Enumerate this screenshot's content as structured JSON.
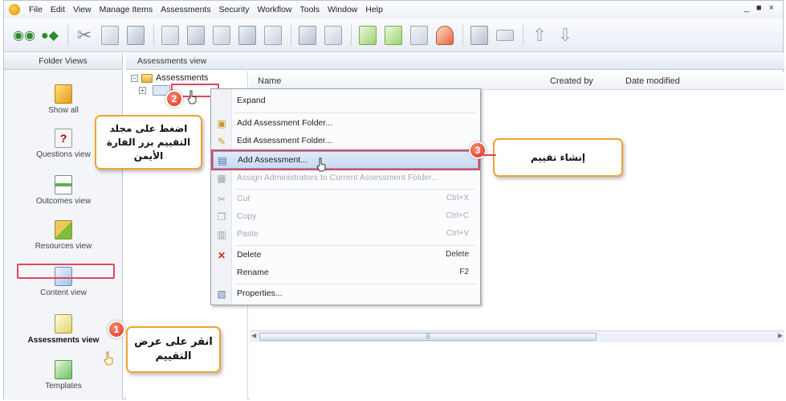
{
  "menu": [
    "File",
    "Edit",
    "View",
    "Manage Items",
    "Assessments",
    "Security",
    "Workflow",
    "Tools",
    "Window",
    "Help"
  ],
  "window_controls": "_ ■ ×",
  "left_pane": {
    "header": "Folder Views",
    "items": [
      {
        "label": "Show all",
        "icon": "cube-icon"
      },
      {
        "label": "Questions view",
        "icon": "question-icon"
      },
      {
        "label": "Outcomes view",
        "icon": "outcomes-icon"
      },
      {
        "label": "Resources view",
        "icon": "resources-icon"
      },
      {
        "label": "Content view",
        "icon": "content-icon"
      },
      {
        "label": "Assessments view",
        "icon": "assessment-icon"
      },
      {
        "label": "Templates",
        "icon": "template-icon"
      }
    ]
  },
  "tree": {
    "header": "Assessments view",
    "root": "Assessments",
    "expander": "−",
    "child_expander": "+"
  },
  "list": {
    "columns": [
      "Name",
      "Created by",
      "Date modified"
    ]
  },
  "context_menu": {
    "items": [
      {
        "label": "Expand",
        "shortcut": "",
        "icon": ""
      },
      {
        "label": "Add Assessment Folder...",
        "shortcut": "",
        "icon": "add-folder-icon"
      },
      {
        "label": "Edit Assessment Folder...",
        "shortcut": "",
        "icon": "edit-folder-icon"
      },
      {
        "label": "Add Assessment...",
        "shortcut": "",
        "icon": "add-assessment-icon"
      },
      {
        "label": "Assign Administrators to Current Assessment Folder...",
        "shortcut": "",
        "icon": "assign-icon"
      },
      {
        "label": "Cut",
        "shortcut": "Ctrl+X",
        "icon": "scissors-icon"
      },
      {
        "label": "Copy",
        "shortcut": "Ctrl+C",
        "icon": "copy-icon"
      },
      {
        "label": "Paste",
        "shortcut": "Ctrl+V",
        "icon": "paste-icon"
      },
      {
        "label": "Delete",
        "shortcut": "Delete",
        "icon": "delete-icon"
      },
      {
        "label": "Rename",
        "shortcut": "F2",
        "icon": ""
      },
      {
        "label": "Properties...",
        "shortcut": "",
        "icon": "properties-icon"
      }
    ]
  },
  "callouts": {
    "step1": {
      "badge": "1",
      "text": "انقر على عرض التقييم"
    },
    "step2": {
      "badge": "2",
      "text": "اضغط على مجلد التقييم بزر الفارة الأيمن"
    },
    "step3": {
      "badge": "3",
      "text": "إنشاء تقييم"
    }
  },
  "colors": {
    "highlight_outline": "#e0475e",
    "callout_border": "#f2a235",
    "badge": "#d8341c",
    "menu_hover": "#c8dbf3"
  }
}
